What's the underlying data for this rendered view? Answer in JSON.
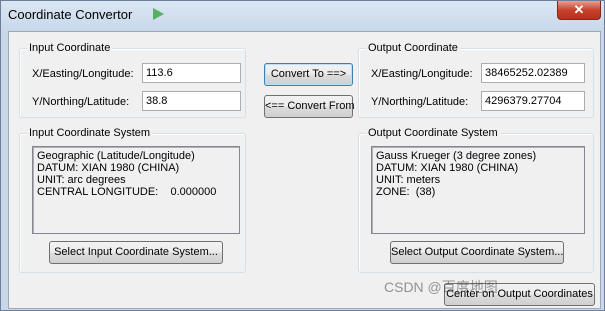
{
  "window": {
    "title": "Coordinate Convertor",
    "close_glyph": "✕"
  },
  "input_coordinate": {
    "legend": "Input Coordinate",
    "x_label": "X/Easting/Longitude:",
    "x_value": "113.6",
    "y_label": "Y/Northing/Latitude:",
    "y_value": "38.8"
  },
  "output_coordinate": {
    "legend": "Output Coordinate",
    "x_label": "X/Easting/Longitude:",
    "x_value": "38465252.02389",
    "y_label": "Y/Northing/Latitude:",
    "y_value": "4296379.27704"
  },
  "convert": {
    "to_label": "Convert To ==>",
    "from_label": "<== Convert From"
  },
  "input_system": {
    "legend": "Input Coordinate System",
    "text": "Geographic (Latitude/Longitude)\nDATUM: XIAN 1980 (CHINA)\nUNIT: arc degrees\nCENTRAL LONGITUDE:    0.000000",
    "select_label": "Select Input Coordinate System..."
  },
  "output_system": {
    "legend": "Output Coordinate System",
    "text": "Gauss Krueger (3 degree zones)\nDATUM: XIAN 1980 (CHINA)\nUNIT: meters\nZONE:  (38)",
    "select_label": "Select Output Coordinate System..."
  },
  "footer": {
    "center_label": "Center on Output Coordinates",
    "watermark": "CSDN @百度地图"
  },
  "colors": {
    "title_decor": "#2f9e3a",
    "close_button": "#c7422d"
  },
  "icons": {
    "title_decor": "green-arrow-icon",
    "close": "close-icon"
  }
}
